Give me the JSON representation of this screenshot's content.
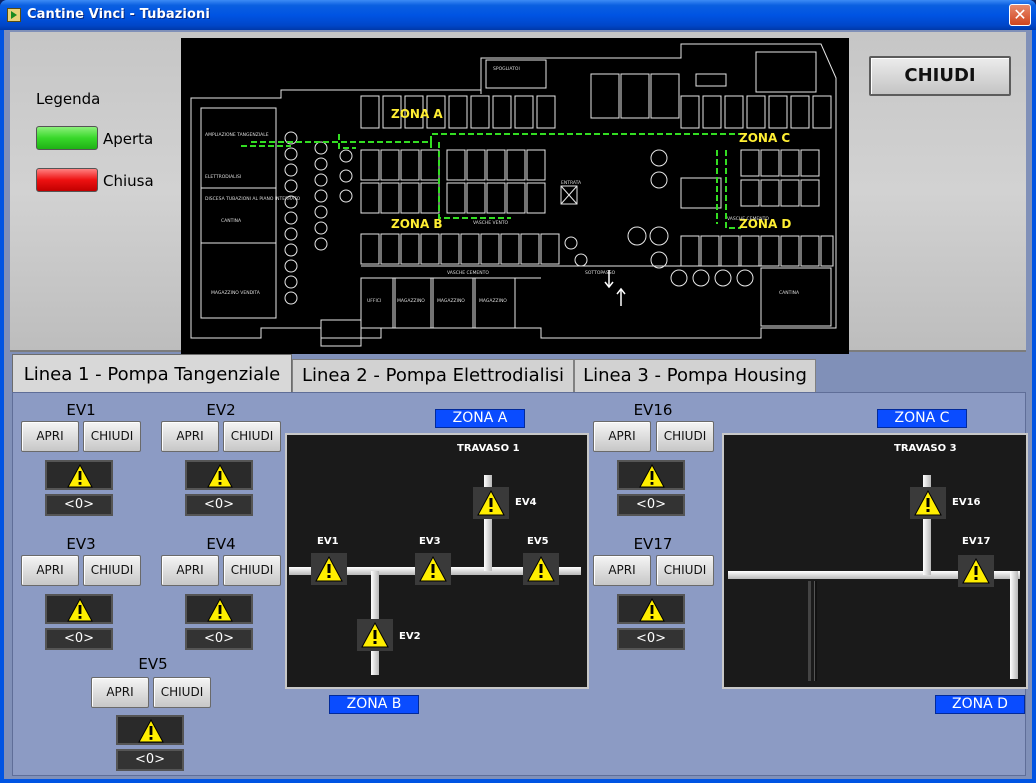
{
  "window": {
    "title": "Cantine Vinci - Tubazioni",
    "close_glyph": "✕"
  },
  "legend": {
    "title": "Legenda",
    "open_label": "Aperta",
    "closed_label": "Chiusa",
    "open_color": "#38d82a",
    "closed_color": "#ee1111"
  },
  "map": {
    "zones": [
      "ZONA A",
      "ZONA B",
      "ZONA C",
      "ZONA D"
    ],
    "room_labels": [
      "AMPLIAZIONE TANGENZIALE",
      "ELETTRODIALISI",
      "DISCESA TUBAZIONI AL PIANO INTERRATO",
      "CANTINA",
      "MAGAZZINO VENDITA",
      "UFFICI",
      "MAGAZZINO",
      "MAGAZZINO",
      "MAGAZZINO",
      "SPOGLIATOI",
      "VASCHE VENTO",
      "VASCHE CEMENTO",
      "VASCHE CEMENTO",
      "SOTTOPASSO",
      "CANTINA",
      "ENTRATA"
    ]
  },
  "main_close_label": "CHIUDI",
  "tabs": [
    {
      "label": "Linea 1 - Pompa Tangenziale",
      "active": true
    },
    {
      "label": "Linea 2 - Pompa Elettrodialisi",
      "active": false
    },
    {
      "label": "Linea 3 - Pompa Housing",
      "active": false
    }
  ],
  "valves": {
    "apri_label": "APRI",
    "chiudi_label": "CHIUDI",
    "value_text": "<0>",
    "items": [
      {
        "name": "EV1"
      },
      {
        "name": "EV2"
      },
      {
        "name": "EV3"
      },
      {
        "name": "EV4"
      },
      {
        "name": "EV5"
      },
      {
        "name": "EV16"
      },
      {
        "name": "EV17"
      }
    ]
  },
  "schema1": {
    "zone_top": "ZONA A",
    "zone_bottom": "ZONA B",
    "title": "TRAVASO 1",
    "valves": [
      "EV1",
      "EV3",
      "EV5",
      "EV4",
      "EV2"
    ]
  },
  "schema2": {
    "zone_top": "ZONA C",
    "zone_bottom": "ZONA D",
    "title": "TRAVASO 3",
    "valves": [
      "EV16",
      "EV17"
    ]
  },
  "icons": {
    "warning": "warning-icon"
  },
  "colors": {
    "zone_tag": "#0a4cff",
    "pane": "#8c9bc4",
    "warning": "#ffee00"
  }
}
